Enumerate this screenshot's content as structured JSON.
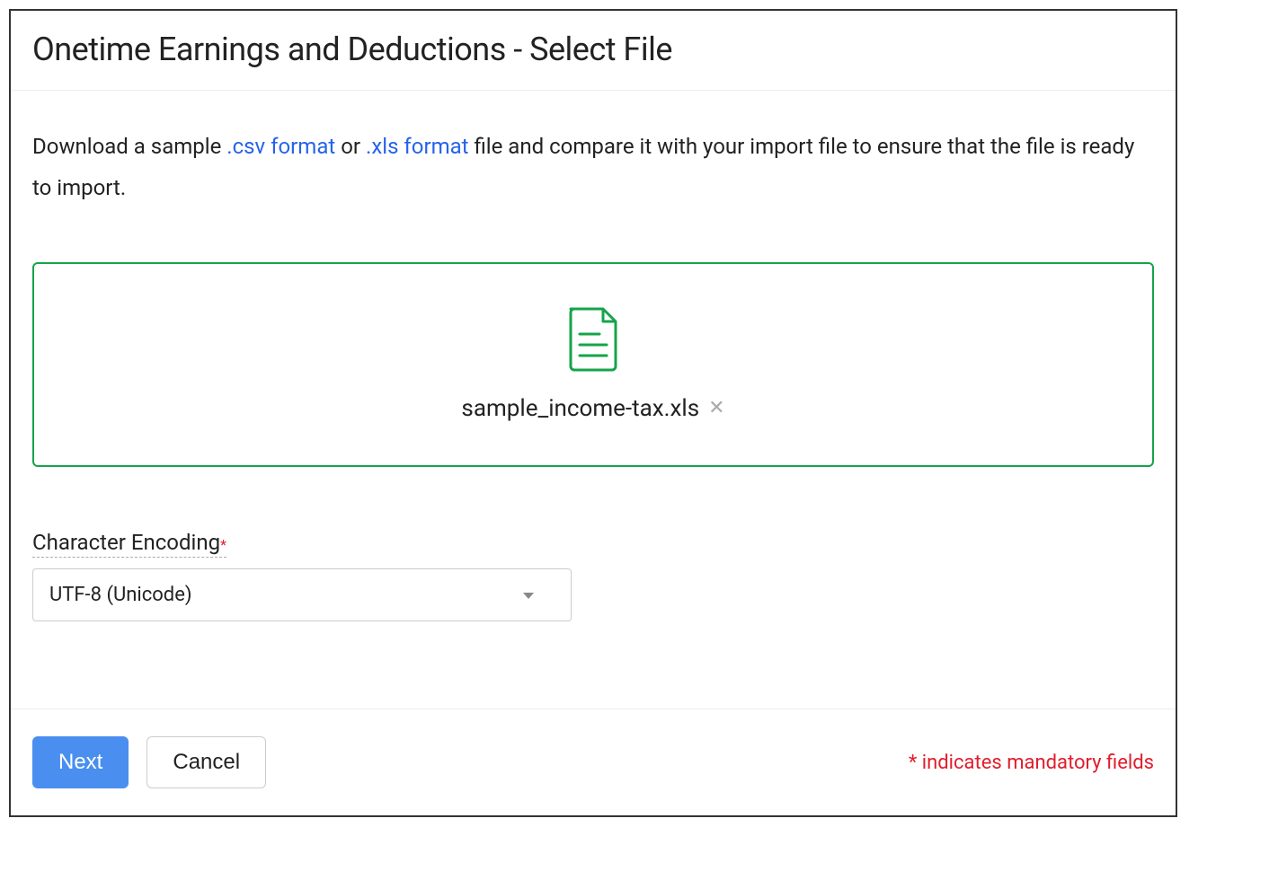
{
  "header": {
    "title": "Onetime Earnings and Deductions - Select File"
  },
  "instruction": {
    "prefix": "Download a sample ",
    "csv_link": ".csv format",
    "middle": " or ",
    "xls_link": ".xls format",
    "suffix": " file and compare it with your import file to ensure that the file is ready to import."
  },
  "dropzone": {
    "file_name": "sample_income-tax.xls"
  },
  "encoding": {
    "label": "Character Encoding",
    "required_mark": "*",
    "selected": "UTF-8 (Unicode)"
  },
  "footer": {
    "next_label": "Next",
    "cancel_label": "Cancel",
    "mandatory_note": "* indicates mandatory fields"
  }
}
